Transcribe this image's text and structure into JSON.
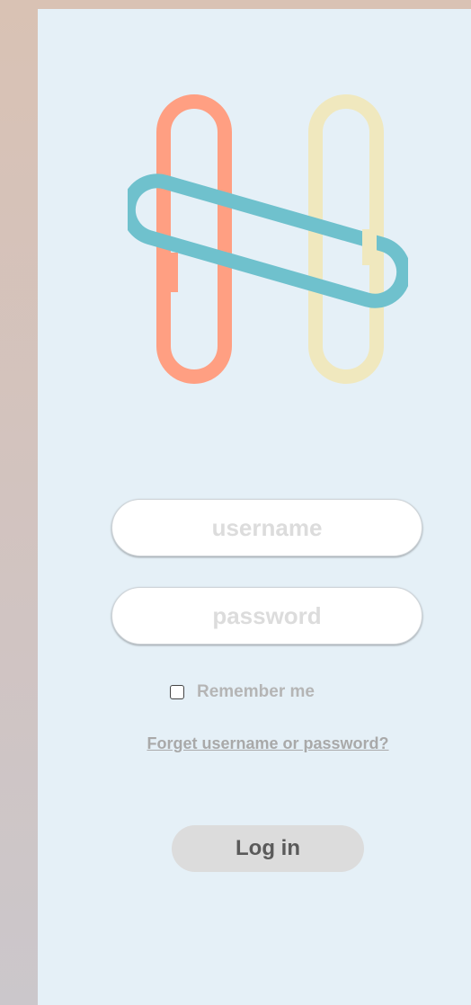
{
  "logo": {
    "icon": "h-links-logo-icon",
    "colors": {
      "left_loop": "#ff9f82",
      "right_loop": "#f0e8be",
      "cross_loop": "#6fc1cd"
    }
  },
  "form": {
    "username_placeholder": "username",
    "password_placeholder": "password",
    "remember_label": "Remember me",
    "remember_checked": false,
    "forgot_link": "Forget username or password?",
    "login_label": "Log in"
  },
  "colors": {
    "panel_bg": "#e5f0f7",
    "button_bg": "#dcdcdc"
  }
}
